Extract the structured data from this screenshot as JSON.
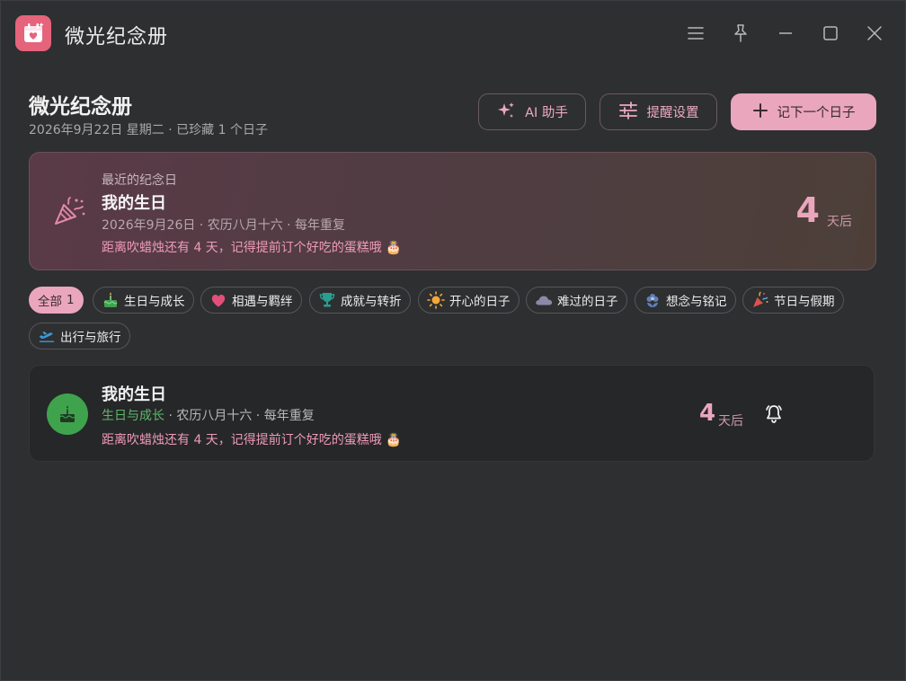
{
  "app": {
    "title": "微光纪念册"
  },
  "header": {
    "title": "微光纪念册",
    "subtitle": "2026年9月22日 星期二 · 已珍藏 1 个日子",
    "ai_button": "AI 助手",
    "remind_button": "提醒设置",
    "add_button": "记下一个日子"
  },
  "hero": {
    "label": "最近的纪念日",
    "name": "我的生日",
    "meta": "2026年9月26日 · 农历八月十六 · 每年重复",
    "message": "距离吹蜡烛还有 4 天，记得提前订个好吃的蛋糕哦 🎂",
    "count": "4",
    "unit": "天后"
  },
  "filters": [
    {
      "label": "全部",
      "count": "1",
      "icon": "",
      "active": true
    },
    {
      "label": "生日与成长",
      "icon": "cake-icon"
    },
    {
      "label": "相遇与羁绊",
      "icon": "heart-icon"
    },
    {
      "label": "成就与转折",
      "icon": "trophy-icon"
    },
    {
      "label": "开心的日子",
      "icon": "sun-icon"
    },
    {
      "label": "难过的日子",
      "icon": "cloud-icon"
    },
    {
      "label": "想念与铭记",
      "icon": "flower-icon"
    },
    {
      "label": "节日与假期",
      "icon": "party-popper-icon"
    },
    {
      "label": "出行与旅行",
      "icon": "airplane-icon"
    }
  ],
  "events": [
    {
      "name": "我的生日",
      "category": "生日与成长",
      "meta": " · 农历八月十六 · 每年重复",
      "message": "距离吹蜡烛还有 4 天，记得提前订个好吃的蛋糕哦 🎂",
      "count": "4",
      "unit": "天后",
      "icon": "cake-icon"
    }
  ],
  "colors": {
    "background": "#2e2f31",
    "accent": "#eaa6bd",
    "accent_text": "#ee9bb8",
    "birthday_green": "#3fa34d"
  }
}
